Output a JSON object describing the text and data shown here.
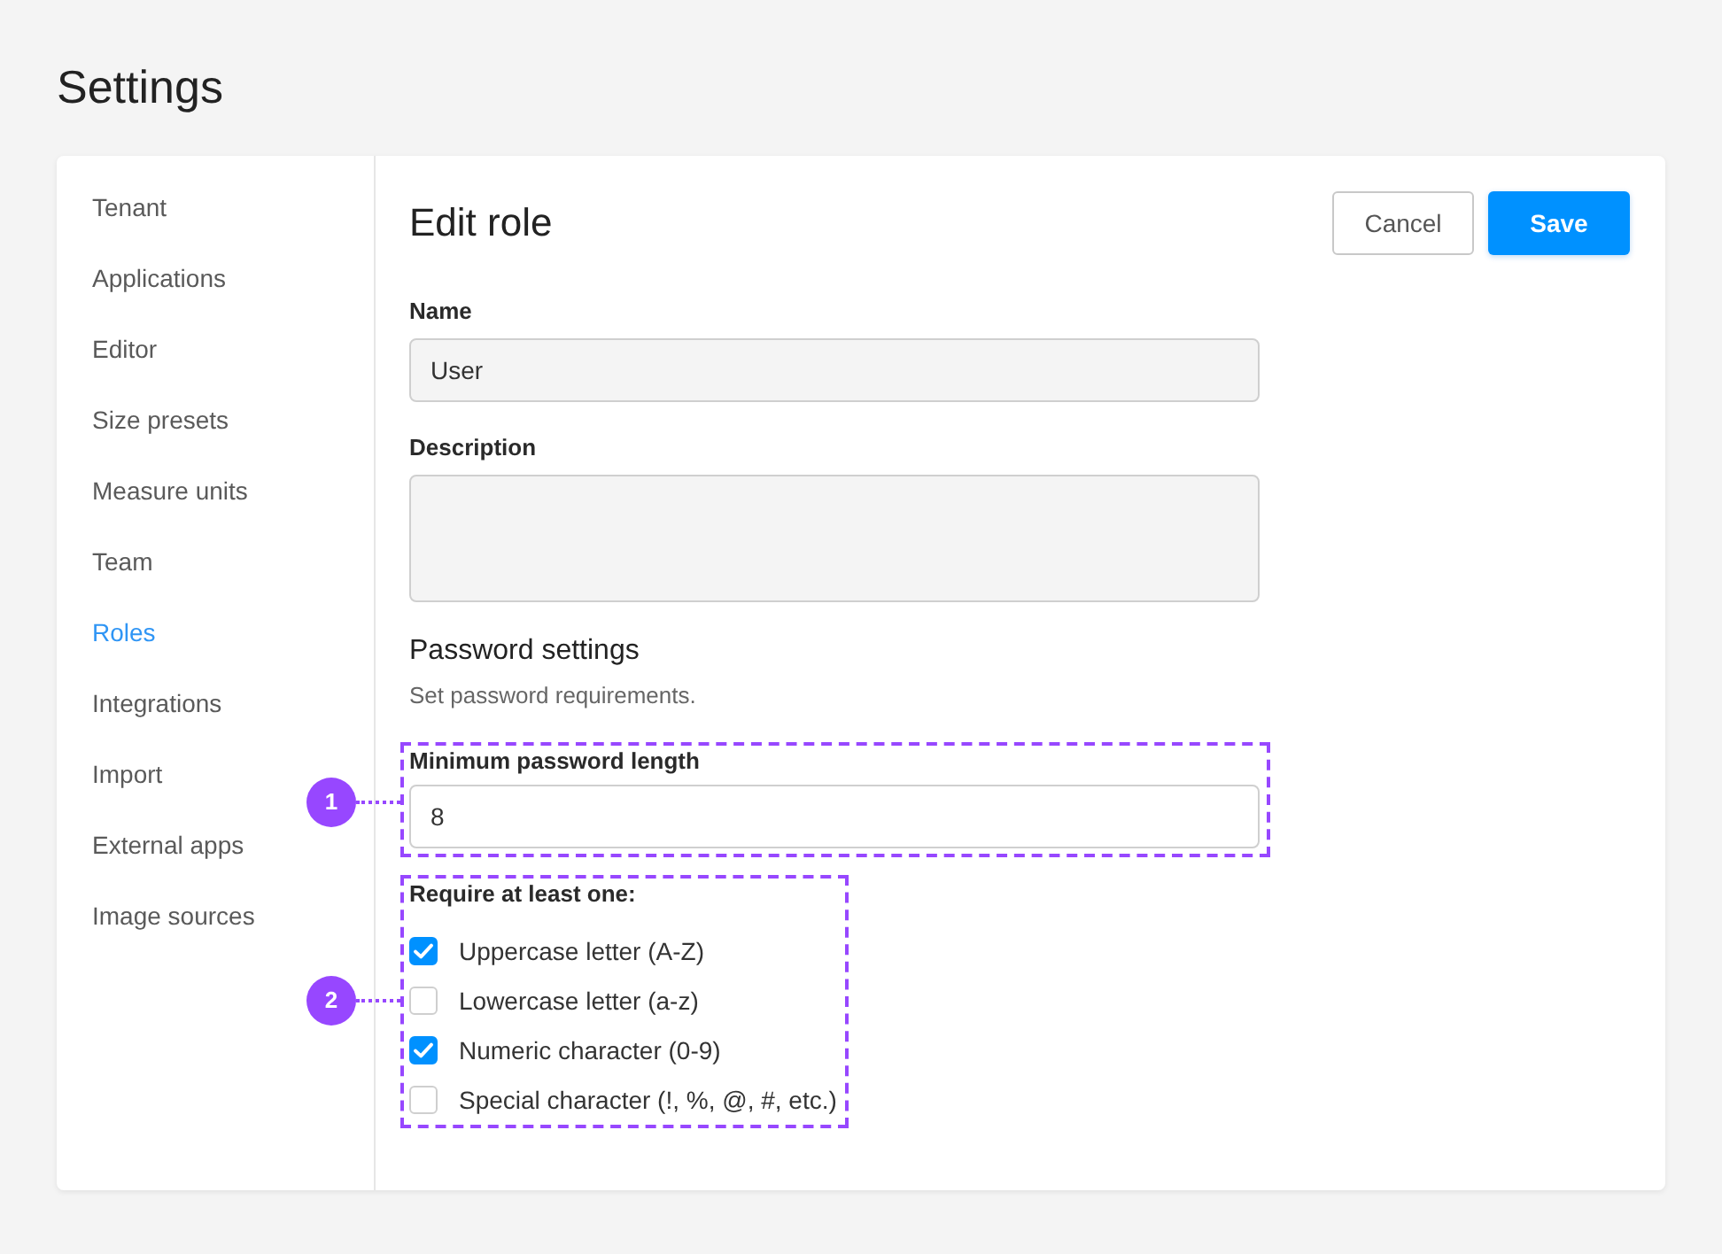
{
  "page": {
    "title": "Settings"
  },
  "sidebar": {
    "items": [
      {
        "label": "Tenant",
        "selected": false
      },
      {
        "label": "Applications",
        "selected": false
      },
      {
        "label": "Editor",
        "selected": false
      },
      {
        "label": "Size presets",
        "selected": false
      },
      {
        "label": "Measure units",
        "selected": false
      },
      {
        "label": "Team",
        "selected": false
      },
      {
        "label": "Roles",
        "selected": true
      },
      {
        "label": "Integrations",
        "selected": false
      },
      {
        "label": "Import",
        "selected": false
      },
      {
        "label": "External apps",
        "selected": false
      },
      {
        "label": "Image sources",
        "selected": false
      }
    ]
  },
  "editor": {
    "title": "Edit role",
    "buttons": [
      {
        "label": "Cancel",
        "kind": "secondary"
      },
      {
        "label": "Save",
        "kind": "primary"
      }
    ],
    "fields": [
      {
        "label": "Name",
        "kind": "input",
        "value": "User"
      },
      {
        "label": "Description",
        "kind": "textarea"
      }
    ],
    "password_section": {
      "title": "Password settings",
      "description": "Set password requirements.",
      "min_length": {
        "callout": "1",
        "label": "Minimum password length",
        "value": "8"
      },
      "requirements": {
        "callout": "2",
        "label": "Require at least one:",
        "options": [
          {
            "label": "Uppercase letter (A-Z)",
            "checked": true
          },
          {
            "label": "Lowercase letter (a-z)",
            "checked": false
          },
          {
            "label": "Numeric character (0-9)",
            "checked": true
          },
          {
            "label": "Special character (!, %, @, #, etc.)",
            "checked": false
          }
        ]
      }
    }
  }
}
